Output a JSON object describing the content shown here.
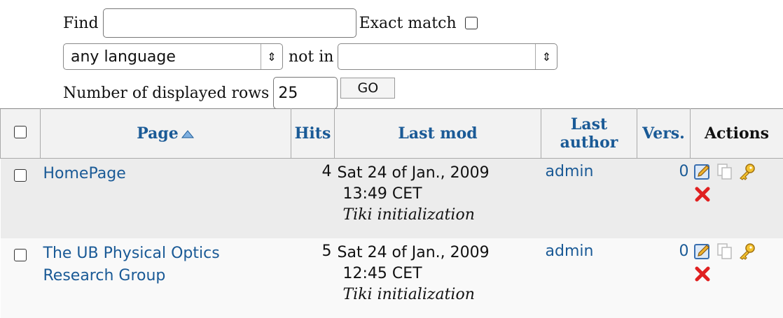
{
  "filter": {
    "find_label": "Find",
    "find_value": "",
    "exact_label": "Exact match",
    "language_value": "any language",
    "not_in_label": "not in",
    "not_in_value": "",
    "rows_label": "Number of displayed rows",
    "rows_value": "25",
    "go_label": "GO"
  },
  "table": {
    "headers": {
      "page": "Page",
      "hits": "Hits",
      "last_mod": "Last mod",
      "last_author_1": "Last",
      "last_author_2": "author",
      "vers": "Vers.",
      "actions": "Actions"
    },
    "rows": [
      {
        "name_1": "HomePage",
        "name_2": "",
        "hits": "4",
        "date": "Sat 24 of Jan., 2009",
        "time": "13:49 CET",
        "comment": "Tiki initialization",
        "author": "admin",
        "version": "0"
      },
      {
        "name_1": "The UB Physical Optics",
        "name_2": "Research Group",
        "hits": "5",
        "date": "Sat 24 of Jan., 2009",
        "time": "12:45 CET",
        "comment": "Tiki initialization",
        "author": "admin",
        "version": "0"
      }
    ]
  },
  "icons": {
    "sort": "sort-ascending-icon",
    "edit": "edit-icon",
    "copy": "copy-icon",
    "permissions": "key-icon",
    "remove": "delete-icon"
  },
  "colors": {
    "link": "#1a5a96",
    "odd_row": "#ececec",
    "even_row": "#f9f9f9"
  }
}
